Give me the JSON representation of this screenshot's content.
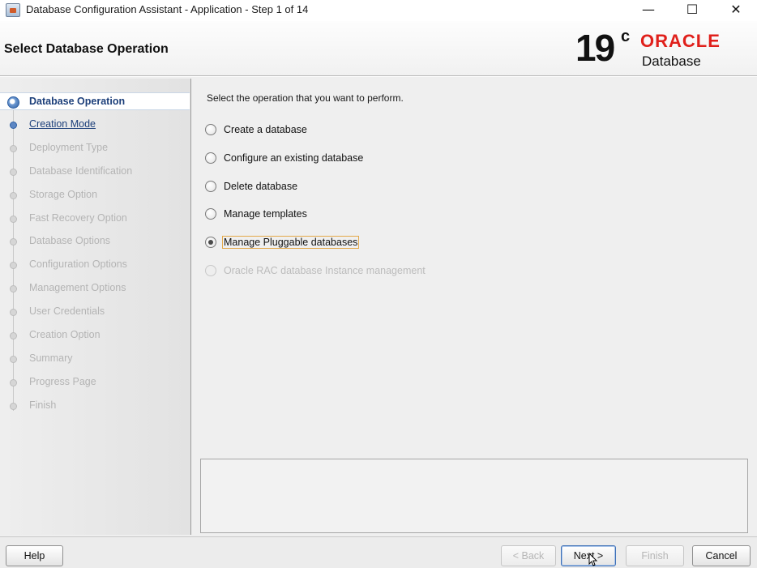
{
  "window": {
    "title": "Database Configuration Assistant - Application - Step 1 of 14",
    "minimize": "—",
    "maximize": "☐",
    "close": "✕"
  },
  "header": {
    "page_title": "Select Database Operation",
    "brand_version": "19",
    "brand_version_sup": "c",
    "brand_name": "ORACLE",
    "brand_product": "Database",
    "brand_color": "#e0201b"
  },
  "nav": {
    "items": [
      {
        "label": "Database Operation",
        "state": "active"
      },
      {
        "label": "Creation Mode",
        "state": "next"
      },
      {
        "label": "Deployment Type",
        "state": "disabled"
      },
      {
        "label": "Database Identification",
        "state": "disabled"
      },
      {
        "label": "Storage Option",
        "state": "disabled"
      },
      {
        "label": "Fast Recovery Option",
        "state": "disabled"
      },
      {
        "label": "Database Options",
        "state": "disabled"
      },
      {
        "label": "Configuration Options",
        "state": "disabled"
      },
      {
        "label": "Management Options",
        "state": "disabled"
      },
      {
        "label": "User Credentials",
        "state": "disabled"
      },
      {
        "label": "Creation Option",
        "state": "disabled"
      },
      {
        "label": "Summary",
        "state": "disabled"
      },
      {
        "label": "Progress Page",
        "state": "disabled"
      },
      {
        "label": "Finish",
        "state": "disabled"
      }
    ]
  },
  "main": {
    "instruction": "Select the operation that you want to perform.",
    "options": [
      {
        "label": "Create a database",
        "checked": false,
        "enabled": true
      },
      {
        "label": "Configure an existing database",
        "checked": false,
        "enabled": true
      },
      {
        "label": "Delete database",
        "checked": false,
        "enabled": true
      },
      {
        "label": "Manage templates",
        "checked": false,
        "enabled": true
      },
      {
        "label": "Manage Pluggable databases",
        "checked": true,
        "enabled": true
      },
      {
        "label": "Oracle RAC database Instance management",
        "checked": false,
        "enabled": false
      }
    ],
    "description": ""
  },
  "buttons": {
    "help": "Help",
    "back": "< Back",
    "next": "Next >",
    "finish": "Finish",
    "cancel": "Cancel"
  }
}
